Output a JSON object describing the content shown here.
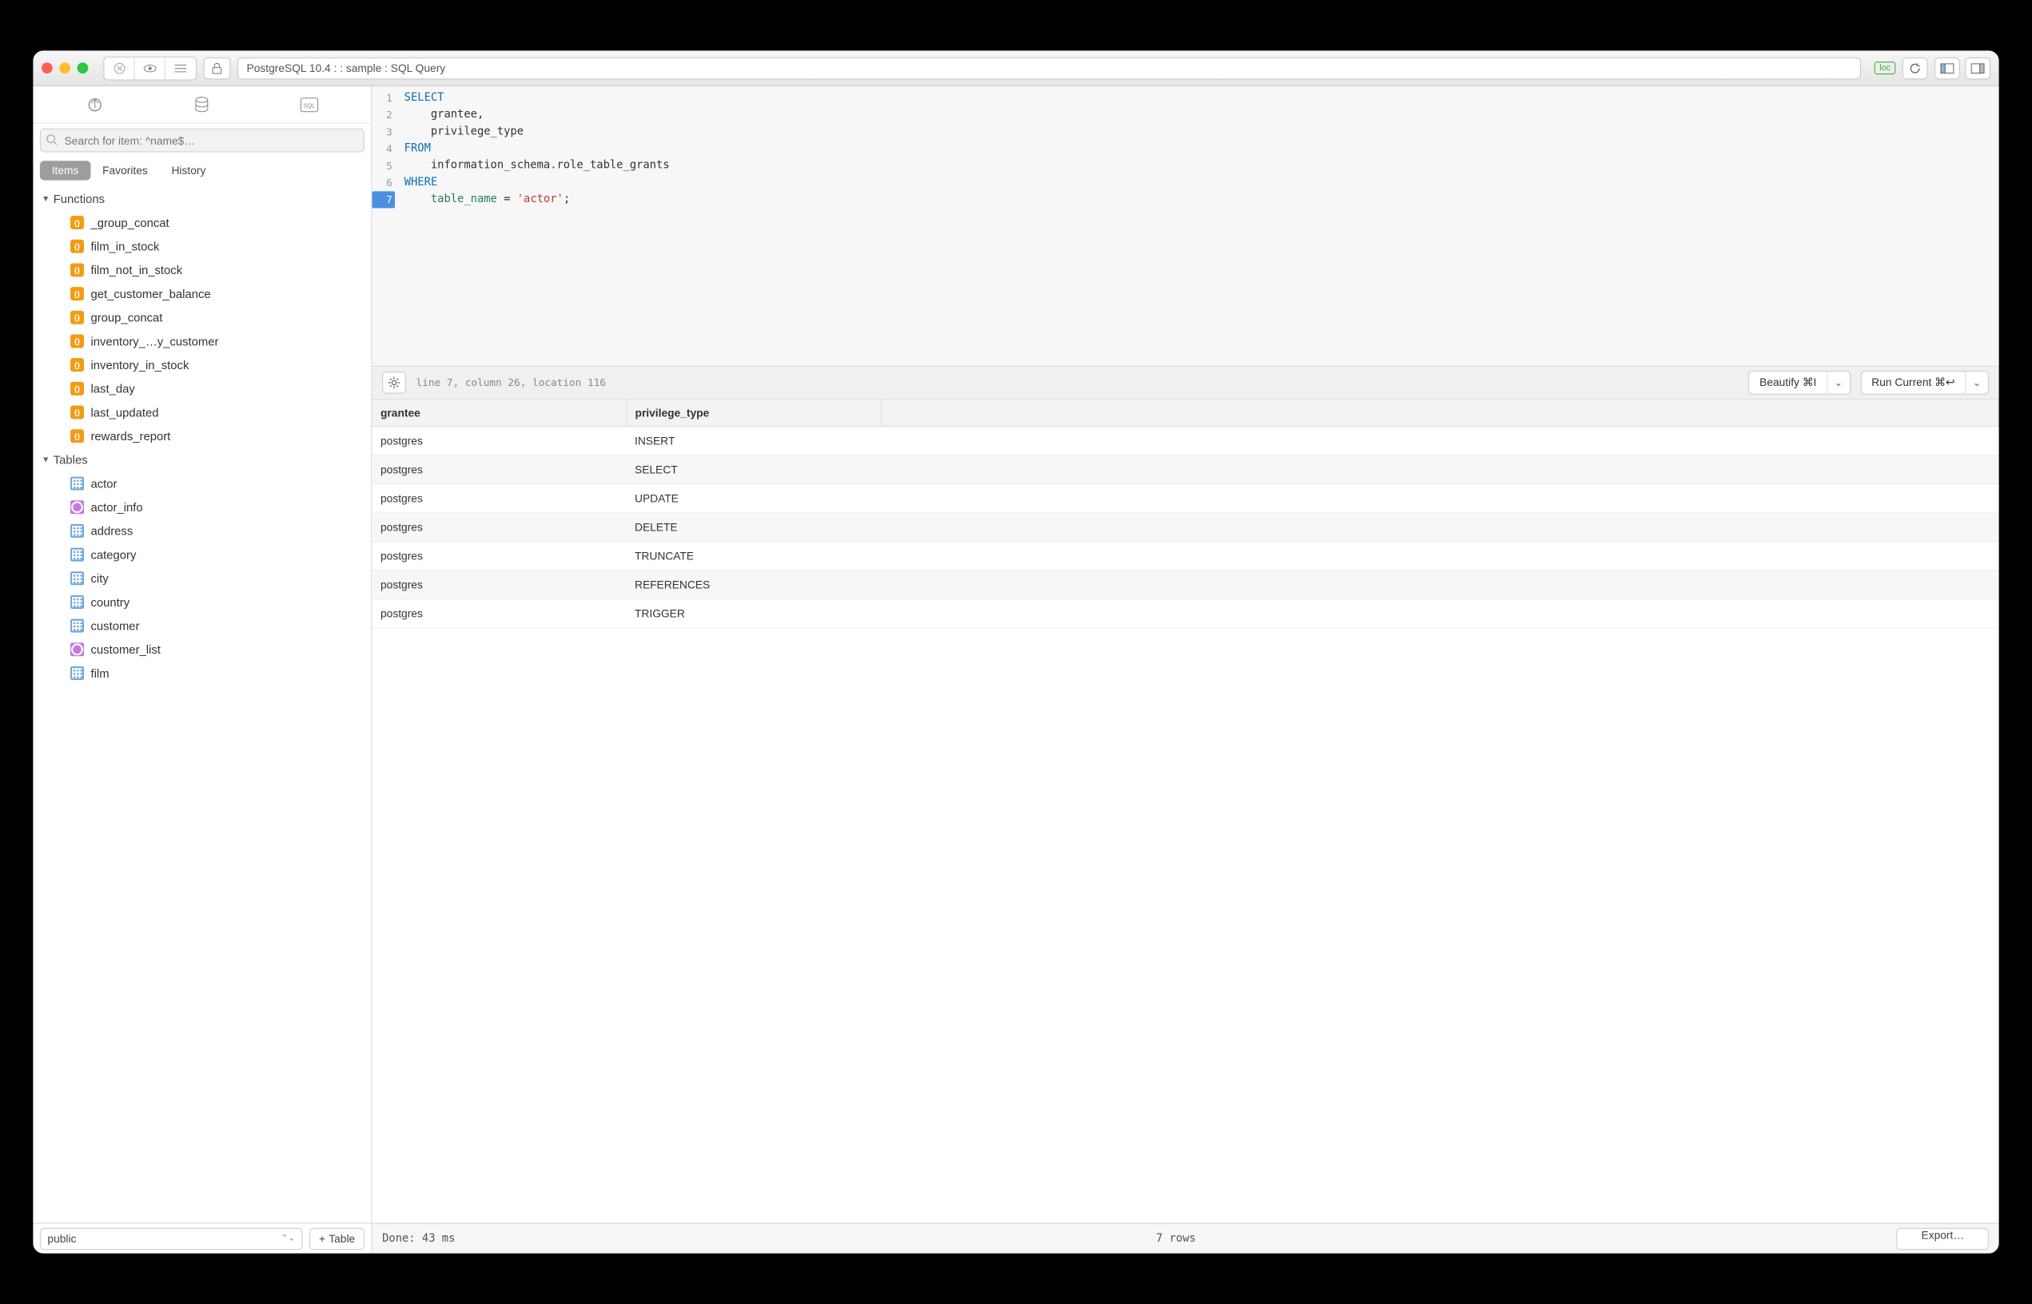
{
  "title": "PostgreSQL 10.4 :  : sample : SQL Query",
  "loc_badge": "loc",
  "search_placeholder": "Search for item: ^name$…",
  "sidebar_tabs": {
    "items": "Items",
    "favorites": "Favorites",
    "history": "History"
  },
  "groups": {
    "functions": "Functions",
    "tables": "Tables"
  },
  "functions": [
    "_group_concat",
    "film_in_stock",
    "film_not_in_stock",
    "get_customer_balance",
    "group_concat",
    "inventory_…y_customer",
    "inventory_in_stock",
    "last_day",
    "last_updated",
    "rewards_report"
  ],
  "tables": [
    {
      "name": "actor",
      "type": "table"
    },
    {
      "name": "actor_info",
      "type": "view"
    },
    {
      "name": "address",
      "type": "table"
    },
    {
      "name": "category",
      "type": "table"
    },
    {
      "name": "city",
      "type": "table"
    },
    {
      "name": "country",
      "type": "table"
    },
    {
      "name": "customer",
      "type": "table"
    },
    {
      "name": "customer_list",
      "type": "view"
    },
    {
      "name": "film",
      "type": "table"
    }
  ],
  "schema": "public",
  "add_table_label": "Table",
  "editor": {
    "lines": [
      "1",
      "2",
      "3",
      "4",
      "5",
      "6",
      "7"
    ],
    "sql_tokens": [
      [
        [
          "kw",
          "SELECT"
        ]
      ],
      [
        [
          "txt",
          "    grantee,"
        ]
      ],
      [
        [
          "txt",
          "    privilege_type"
        ]
      ],
      [
        [
          "kw",
          "FROM"
        ]
      ],
      [
        [
          "txt",
          "    information_schema.role_table_grants"
        ]
      ],
      [
        [
          "kw",
          "WHERE"
        ]
      ],
      [
        [
          "txt",
          "    "
        ],
        [
          "ident",
          "table_name"
        ],
        [
          "txt",
          " = "
        ],
        [
          "str",
          "'actor'"
        ],
        [
          "txt",
          ";"
        ]
      ]
    ],
    "status": "line 7, column 26, location 116",
    "beautify_label": "Beautify ⌘I",
    "run_label": "Run Current ⌘↩"
  },
  "results": {
    "columns": [
      "grantee",
      "privilege_type"
    ],
    "rows": [
      [
        "postgres",
        "INSERT"
      ],
      [
        "postgres",
        "SELECT"
      ],
      [
        "postgres",
        "UPDATE"
      ],
      [
        "postgres",
        "DELETE"
      ],
      [
        "postgres",
        "TRUNCATE"
      ],
      [
        "postgres",
        "REFERENCES"
      ],
      [
        "postgres",
        "TRIGGER"
      ]
    ]
  },
  "footer": {
    "done": "Done: 43 ms",
    "rows": "7 rows",
    "export": "Export…"
  }
}
